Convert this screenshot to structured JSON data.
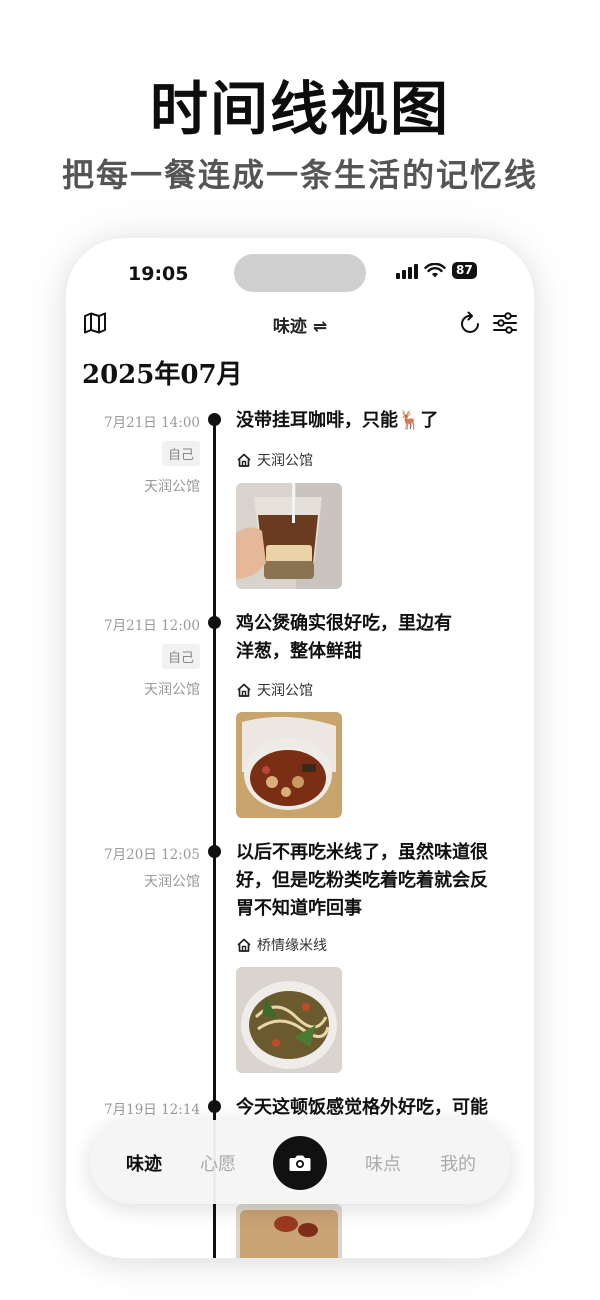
{
  "hero": {
    "title": "时间线视图",
    "subtitle": "把每一餐连成一条生活的记忆线"
  },
  "status_bar": {
    "time": "19:05",
    "battery": "87",
    "icons": [
      "signal-icon",
      "wifi-icon",
      "battery-icon"
    ]
  },
  "nav": {
    "title": "味迹 ⇌",
    "left_icon": "map-icon",
    "right_icons": [
      "refresh-icon",
      "filter-icon"
    ]
  },
  "timeline": {
    "month": "2025年07月",
    "entries": [
      {
        "time": "7月21日 14:00",
        "tag": "自己",
        "place": "天润公馆",
        "text": "没带挂耳咖啡，只能🦌了",
        "location": "天润公馆"
      },
      {
        "time": "7月21日 12:00",
        "tag": "自己",
        "place": "天润公馆",
        "text": "鸡公煲确实很好吃，里边有洋葱，整体鲜甜",
        "location": "天润公馆"
      },
      {
        "time": "7月20日 12:05",
        "tag": "",
        "place": "天润公馆",
        "text": "以后不再吃米线了，虽然味道很好，但是吃粉类吃着吃着就会反胃不知道咋回事",
        "location": "桥情缘米线"
      },
      {
        "time": "7月19日 12:14",
        "tag": "",
        "place": "",
        "text": "今天这顿饭感觉格外好吃，可能",
        "location": ""
      }
    ]
  },
  "tabbar": {
    "tabs": [
      "味迹",
      "心愿",
      "味点",
      "我的"
    ],
    "active": "味迹",
    "camera_icon": "camera-icon"
  }
}
